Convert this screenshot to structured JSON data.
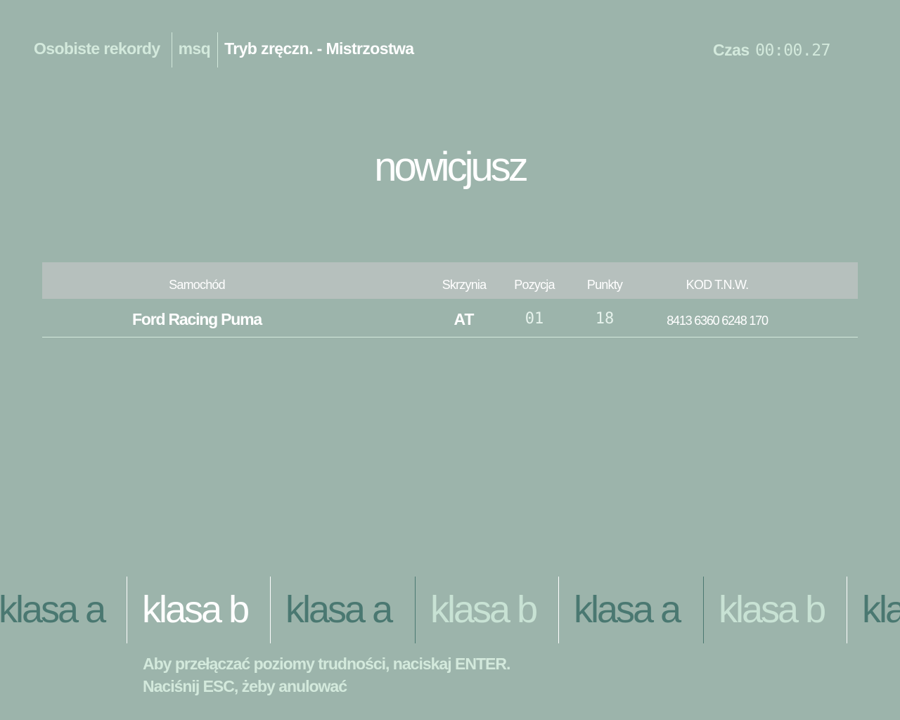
{
  "header": {
    "records_label": "Osobiste rekordy",
    "user": "msq",
    "mode": "Tryb zręczn. - Mistrzostwa"
  },
  "timer": {
    "label": "Czas",
    "value": "00:00.27"
  },
  "difficulty_title": "nowicjusz",
  "table": {
    "columns": [
      "Samochód",
      "Skrzynia",
      "Pozycja",
      "Punkty",
      "KOD T.N.W."
    ],
    "row": {
      "car": "Ford Racing Puma",
      "gearbox": "AT",
      "position": "01",
      "points": "18",
      "code": "8413 6360 6248 170"
    }
  },
  "class_carousel": {
    "items": [
      "klasa a",
      "klasa b",
      "klasa a",
      "klasa b",
      "klasa a",
      "klasa b",
      "klasa a"
    ],
    "selected_index": 1,
    "colors": {
      "selected": "#ffffff",
      "dark": "#4a7871",
      "light": "#c8e2d4"
    }
  },
  "hints": {
    "line1": "Aby przełączać poziomy trudności, naciskaj ENTER.",
    "line2": "Naciśnij ESC, żeby anulować"
  }
}
